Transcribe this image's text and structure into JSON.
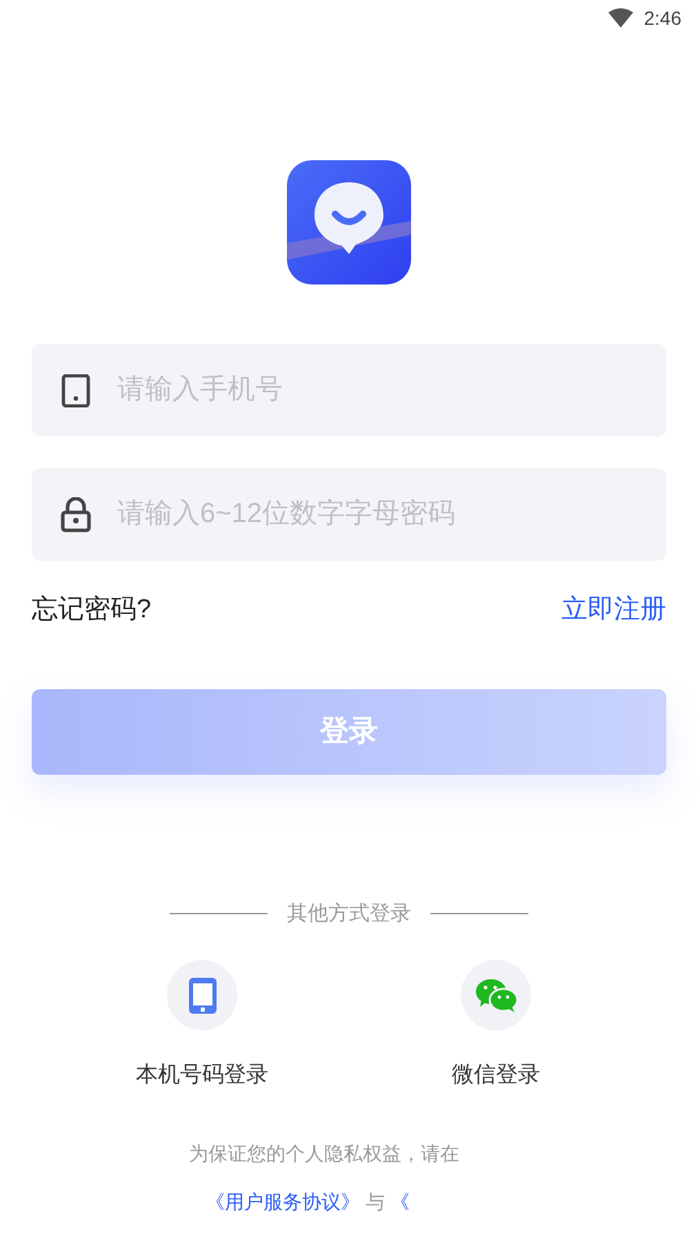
{
  "status_bar": {
    "time": "2:46"
  },
  "fields": [
    {
      "kind": "phone",
      "placeholder": "请输入手机号"
    },
    {
      "kind": "password",
      "placeholder": "请输入6~12位数字字母密码"
    }
  ],
  "forgot_link": "忘记密码?",
  "register_link": "立即注册",
  "login_button": {
    "label": "登录",
    "disabled": true
  },
  "other_methods": {
    "title": "其他方式登录",
    "items": [
      {
        "kind": "phone",
        "label": "本机号码登录"
      },
      {
        "kind": "wechat",
        "label": "微信登录"
      }
    ]
  },
  "privacy": {
    "text": "为保证您的个人隐私权益，请在",
    "links": [
      "《用户服务协议》",
      "《"
    ],
    "separator": "与"
  }
}
